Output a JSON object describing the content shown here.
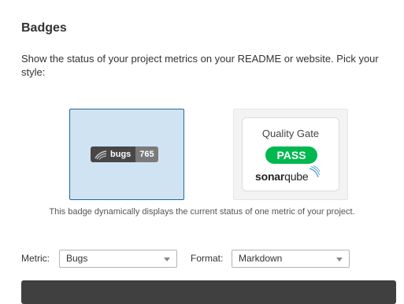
{
  "title": "Badges",
  "description": "Show the status of your project metrics on your README or website. Pick your style:",
  "badges": {
    "metric": {
      "label": "bugs",
      "value": "765"
    },
    "quality_gate": {
      "title": "Quality Gate",
      "status": "PASS",
      "logo_bold": "sonar",
      "logo_light": "qube"
    },
    "caption": "This badge dynamically displays the current status of one metric of your project."
  },
  "form": {
    "metric_label": "Metric:",
    "metric_value": "Bugs",
    "format_label": "Format:",
    "format_value": "Markdown"
  },
  "colors": {
    "selected_bg": "#cfe3f3",
    "selected_border": "#236a97",
    "pass_green": "#00b84f",
    "badge_dark": "#474747",
    "badge_value": "#7a7a7a",
    "code_bg": "#404040"
  },
  "icons": {
    "badge_logo": "sonar-waves-icon",
    "select_arrow": "chevron-down-icon"
  }
}
